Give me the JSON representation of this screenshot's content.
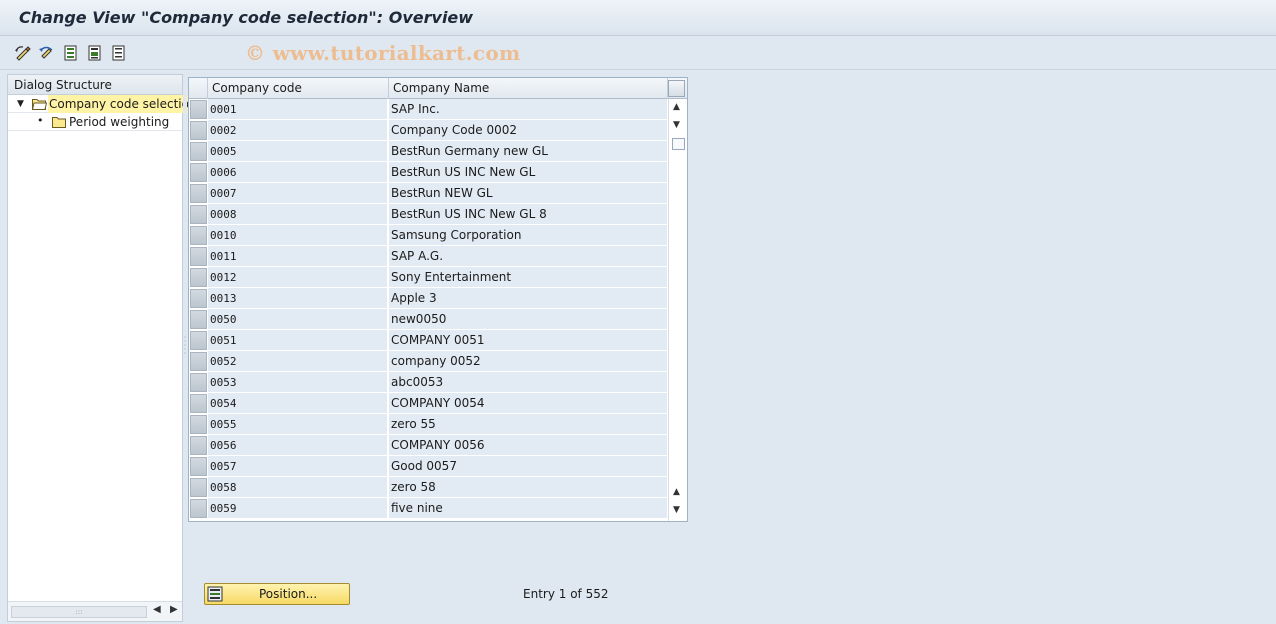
{
  "window": {
    "title": "Change View \"Company code selection\": Overview"
  },
  "toolbar": {
    "buttons": [
      {
        "icon": "display-change-icon"
      },
      {
        "icon": "undo-icon"
      },
      {
        "icon": "select-all-icon"
      },
      {
        "icon": "select-block-icon"
      },
      {
        "icon": "deselect-all-icon"
      }
    ],
    "watermark": "© www.tutorialkart.com"
  },
  "dialog_structure": {
    "header": "Dialog Structure",
    "items": [
      {
        "label": "Company code selection",
        "selected": true,
        "expanded": true,
        "level": 0
      },
      {
        "label": "Period weighting",
        "selected": false,
        "level": 1
      }
    ]
  },
  "table": {
    "columns": [
      "Company code",
      "Company Name"
    ],
    "rows": [
      {
        "code": "0001",
        "name": "SAP Inc."
      },
      {
        "code": "0002",
        "name": "Company Code 0002"
      },
      {
        "code": "0005",
        "name": "BestRun Germany new GL"
      },
      {
        "code": "0006",
        "name": "BestRun US INC New GL"
      },
      {
        "code": "0007",
        "name": "BestRun NEW GL"
      },
      {
        "code": "0008",
        "name": "BestRun US INC New GL 8"
      },
      {
        "code": "0010",
        "name": "Samsung Corporation"
      },
      {
        "code": "0011",
        "name": "SAP A.G."
      },
      {
        "code": "0012",
        "name": "Sony Entertainment"
      },
      {
        "code": "0013",
        "name": "Apple 3"
      },
      {
        "code": "0050",
        "name": "new0050"
      },
      {
        "code": "0051",
        "name": "COMPANY 0051"
      },
      {
        "code": "0052",
        "name": "company 0052"
      },
      {
        "code": "0053",
        "name": "abc0053"
      },
      {
        "code": "0054",
        "name": "COMPANY 0054"
      },
      {
        "code": "0055",
        "name": "zero 55"
      },
      {
        "code": "0056",
        "name": "COMPANY 0056"
      },
      {
        "code": "0057",
        "name": "Good 0057"
      },
      {
        "code": "0058",
        "name": "zero 58"
      },
      {
        "code": "0059",
        "name": "five nine"
      }
    ]
  },
  "footer": {
    "position_button": "Position...",
    "entry_text": "Entry 1 of 552"
  },
  "colors": {
    "background": "#dfe8f1",
    "row_fill": "#e2ebf4",
    "selected_node": "#fff3a6",
    "button_fill": "#f6d965"
  }
}
